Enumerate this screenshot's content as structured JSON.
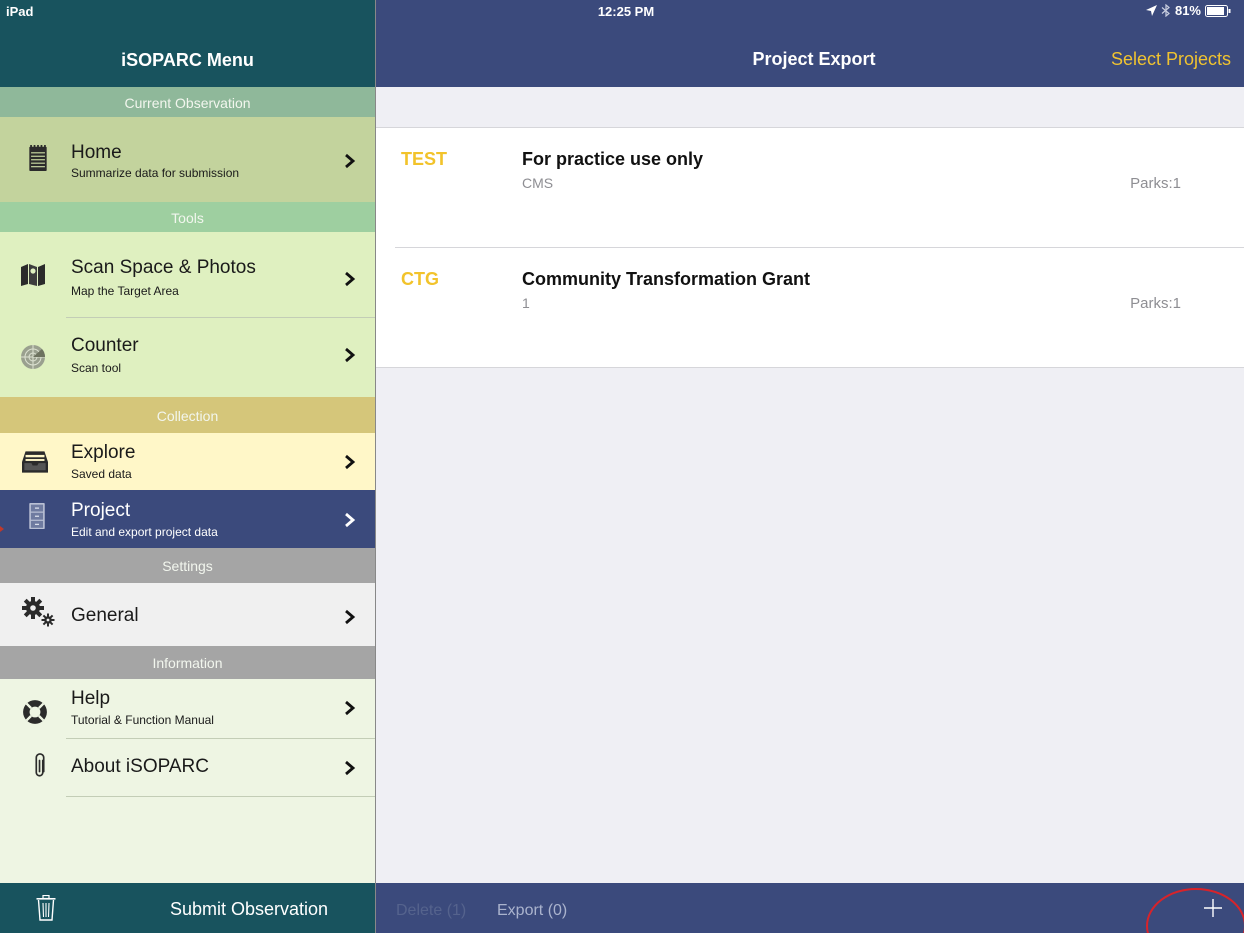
{
  "status_bar": {
    "carrier": "iPad",
    "time": "12:25 PM",
    "battery": "81%",
    "icons": [
      "location-arrow-icon",
      "bluetooth-icon",
      "battery-icon"
    ]
  },
  "sidebar": {
    "title": "iSOPARC Menu",
    "sections": {
      "current_observation": "Current Observation",
      "tools": "Tools",
      "collection": "Collection",
      "settings": "Settings",
      "information": "Information"
    },
    "items": [
      {
        "id": "home",
        "title": "Home",
        "subtitle": "Summarize data for submission",
        "icon": "notepad-icon"
      },
      {
        "id": "scan",
        "title": "Scan Space & Photos",
        "subtitle": "Map the Target Area",
        "icon": "map-icon"
      },
      {
        "id": "counter",
        "title": "Counter",
        "subtitle": "Scan tool",
        "icon": "radar-icon"
      },
      {
        "id": "explore",
        "title": "Explore",
        "subtitle": "Saved data",
        "icon": "inbox-icon"
      },
      {
        "id": "project",
        "title": "Project",
        "subtitle": "Edit and export project data",
        "icon": "file-cabinet-icon"
      },
      {
        "id": "general",
        "title": "General",
        "subtitle": "",
        "icon": "gears-icon"
      },
      {
        "id": "help",
        "title": "Help",
        "subtitle": "Tutorial & Function Manual",
        "icon": "lifebuoy-icon"
      },
      {
        "id": "about",
        "title": "About iSOPARC",
        "subtitle": "",
        "icon": "paperclip-icon"
      }
    ],
    "footer": {
      "submit_label": "Submit Observation",
      "icon": "trash-icon"
    }
  },
  "main": {
    "title": "Project Export",
    "select_label": "Select Projects",
    "projects": [
      {
        "code": "TEST",
        "name": "For practice use only",
        "org": "CMS",
        "parks": "Parks:1"
      },
      {
        "code": "CTG",
        "name": "Community Transformation Grant",
        "org": "1",
        "parks": "Parks:1"
      }
    ],
    "toolbar": {
      "delete_label": "Delete (1)",
      "export_label": "Export (0)",
      "add_icon": "plus-icon"
    }
  },
  "colors": {
    "sidebar_header": "#18535e",
    "nav_bar": "#3b4a7c",
    "accent_yellow": "#f2c32b",
    "annotation_red": "#d8232a"
  }
}
